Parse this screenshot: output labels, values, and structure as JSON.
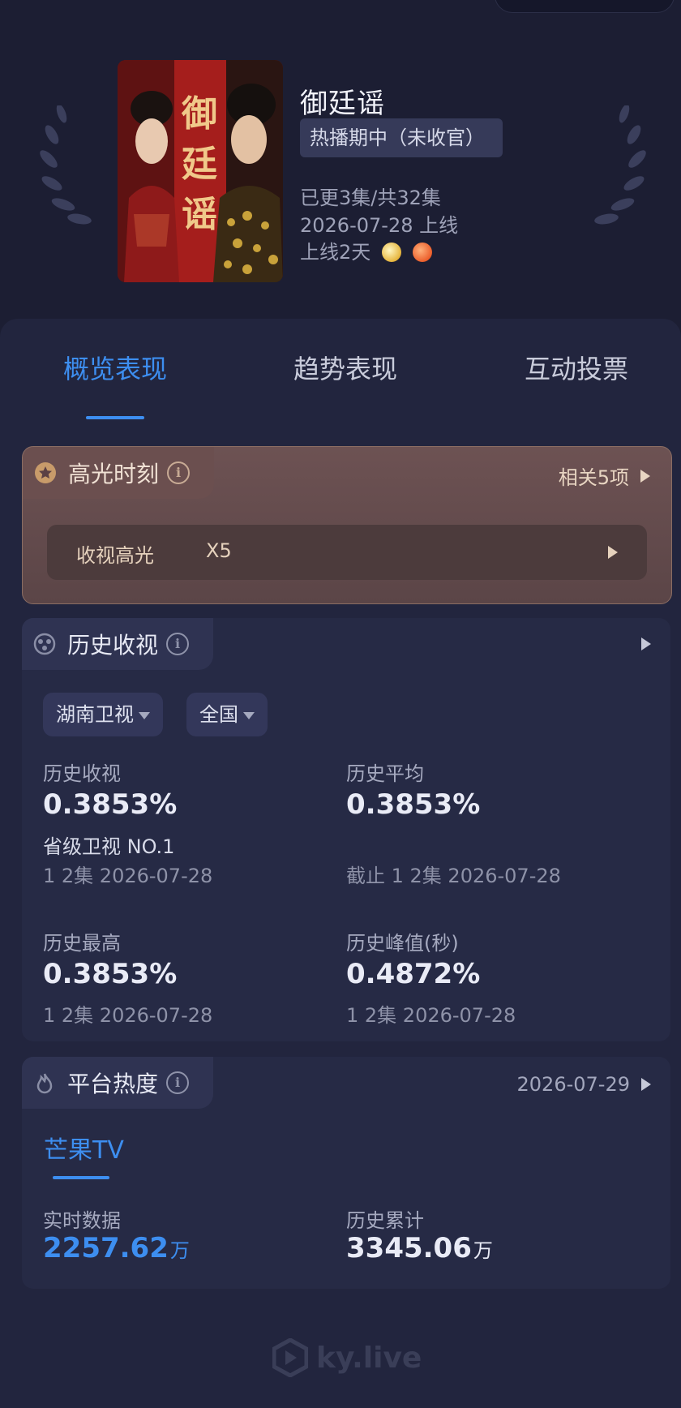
{
  "drama": {
    "title": "御廷谣",
    "poster_text": "御廷谣",
    "status": "热播期中（未收官）",
    "episodes": "已更3集/共32集",
    "release": "2026-07-28 上线",
    "online": "上线2天",
    "platform_icons": [
      "hunan-tv-icon",
      "mango-tv-icon"
    ]
  },
  "tabs": [
    "概览表现",
    "趋势表现",
    "互动投票"
  ],
  "active_tab": 0,
  "highlight": {
    "title": "高光时刻",
    "related": "相关5项",
    "row_label": "收视高光",
    "row_value": "X5"
  },
  "history": {
    "title": "历史收视",
    "channel": "湖南卫视",
    "region": "全国",
    "stats": [
      {
        "label": "历史收视",
        "value": "0.3853%",
        "rank": "省级卫视 NO.1",
        "sub": "1 2集 2026-07-28"
      },
      {
        "label": "历史平均",
        "value": "0.3853%",
        "sub": "截止 1 2集 2026-07-28"
      },
      {
        "label": "历史最高",
        "value": "0.3853%",
        "sub": "1 2集 2026-07-28"
      },
      {
        "label": "历史峰值(秒)",
        "value": "0.4872%",
        "sub": "1 2集 2026-07-28"
      }
    ]
  },
  "heat": {
    "title": "平台热度",
    "date": "2026-07-29",
    "platform_tab": "芒果TV",
    "realtime_label": "实时数据",
    "realtime_value": "2257.62",
    "total_label": "历史累计",
    "total_value": "3345.06",
    "unit": "万"
  },
  "watermark": "ky.live",
  "colors": {
    "accent": "#3d8ef0",
    "background": "#1c1e33",
    "card": "#262a45",
    "highlight_card": "#6d5253"
  }
}
